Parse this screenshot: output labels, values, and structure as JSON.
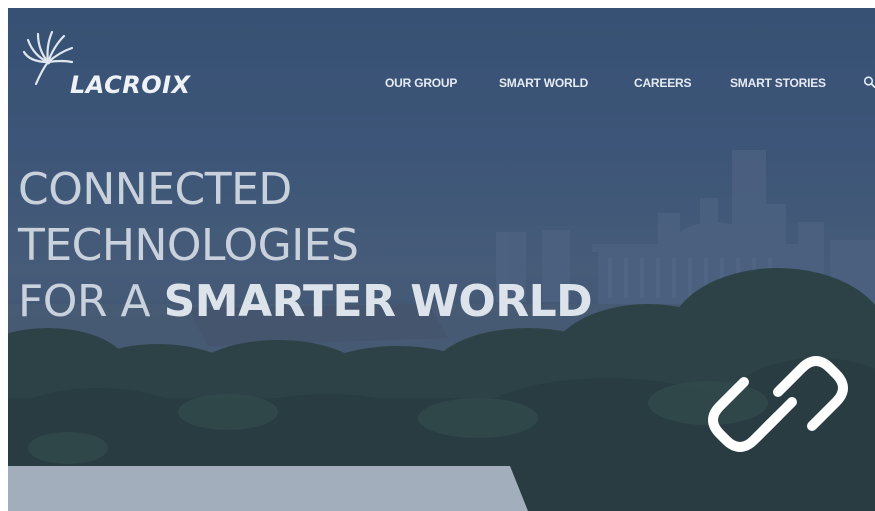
{
  "brand": {
    "name": "LACROIX",
    "logo_icon": "fan-swirl-logo"
  },
  "nav": {
    "items": [
      {
        "label": "OUR GROUP"
      },
      {
        "label": "SMART WORLD"
      },
      {
        "label": "CAREERS"
      },
      {
        "label": "SMART STORIES"
      }
    ],
    "search_icon": "search-icon"
  },
  "hero": {
    "headline_line1": "CONNECTED",
    "headline_line2": "TECHNOLOGIES",
    "headline_line3_lead": "FOR A ",
    "headline_line3_bold": "SMARTER WORLD"
  },
  "overlay_icon": "link-icon",
  "colors": {
    "nav_text": "#e6ebf2",
    "headline": "#c9d2dc",
    "overlay_tint": "#22365c",
    "panel": "#a2aebb",
    "icon_stroke": "#ffffff"
  }
}
